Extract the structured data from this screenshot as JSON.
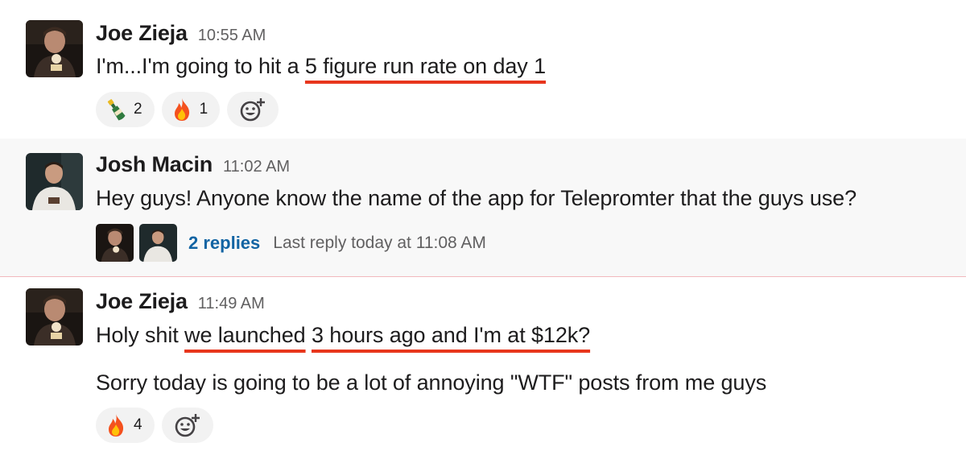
{
  "colors": {
    "underline": "#e8361d",
    "link": "#1264a3",
    "highlight_bg": "#f8f8f8",
    "divider": "#f2b8bd"
  },
  "messages": [
    {
      "author": "Joe Zieja",
      "time": "10:55 AM",
      "line1": {
        "pre": "I'm...I'm going to hit a ",
        "underlined": "5 figure run rate on day 1"
      },
      "reactions": [
        {
          "emoji": "champagne-icon",
          "count": "2"
        },
        {
          "emoji": "fire-icon",
          "count": "1"
        }
      ]
    },
    {
      "author": "Josh Macin",
      "time": "11:02 AM",
      "text": "Hey guys! Anyone know the name of the app for Telepromter that the guys use?",
      "thread": {
        "replies": "2 replies",
        "last_reply": "Last reply today at 11:08 AM"
      }
    },
    {
      "author": "Joe Zieja",
      "time": "11:49 AM",
      "line1": {
        "pre": "Holy shit ",
        "underlined_a": "we launched",
        "gap": " ",
        "underlined_b": "3 hours ago and I'm at $12k?"
      },
      "line2": "Sorry today is going to be a lot of annoying \"WTF\" posts from me guys",
      "reactions": [
        {
          "emoji": "fire-icon",
          "count": "4"
        }
      ]
    }
  ]
}
